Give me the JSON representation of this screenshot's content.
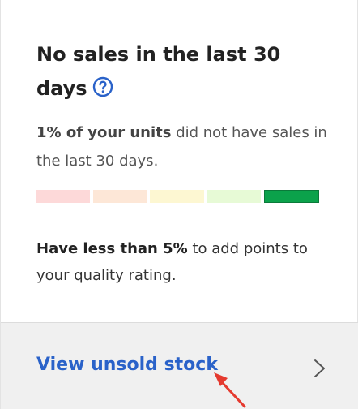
{
  "card": {
    "title": "No sales in the last 30 days",
    "help_icon": "question-circle-icon",
    "desc_bold": "1% of your units",
    "desc_rest": " did not have sales in the last 30 days.",
    "meter": {
      "segments": [
        "#fdd9d9",
        "#fde7d7",
        "#fdf7d2",
        "#e7fad6",
        "#0ba24b"
      ],
      "active_index": 4
    },
    "advice_bold": "Have less than 5%",
    "advice_rest": " to add points to your quality rating."
  },
  "footer": {
    "link_label": "View unsold stock",
    "chevron_icon": "chevron-right-icon",
    "link_color": "#2a62c9"
  },
  "cursor_icon": "red-arrow-cursor-icon"
}
